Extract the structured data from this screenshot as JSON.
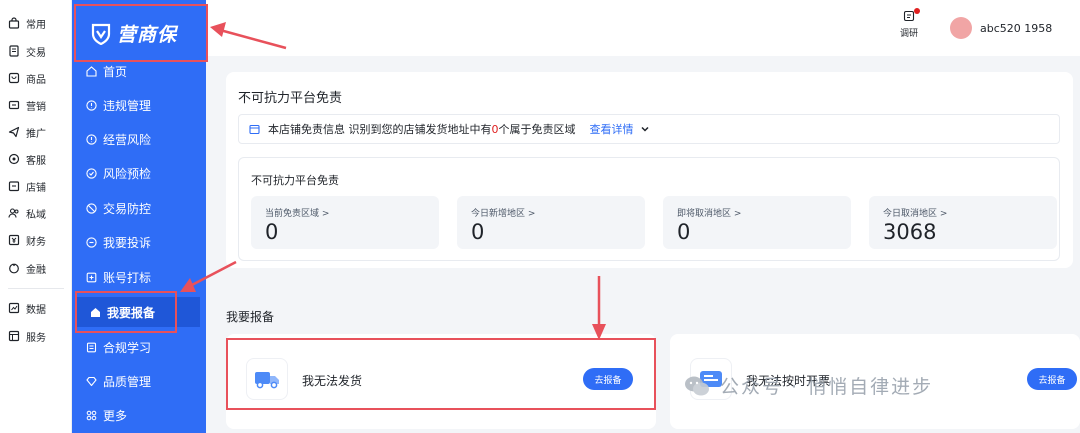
{
  "rail": {
    "items": [
      {
        "label": "常用",
        "icon": "bag-icon"
      },
      {
        "label": "交易",
        "icon": "document-icon"
      },
      {
        "label": "商品",
        "icon": "product-icon"
      },
      {
        "label": "营销",
        "icon": "ticket-icon"
      },
      {
        "label": "推广",
        "icon": "send-icon"
      },
      {
        "label": "客服",
        "icon": "headset-icon"
      },
      {
        "label": "店铺",
        "icon": "store-icon"
      },
      {
        "label": "私域",
        "icon": "people-icon"
      },
      {
        "label": "财务",
        "icon": "finance-icon"
      },
      {
        "label": "金融",
        "icon": "coin-icon"
      },
      {
        "label": "数据",
        "icon": "chart-icon"
      },
      {
        "label": "服务",
        "icon": "service-icon"
      }
    ]
  },
  "sidebar": {
    "logo_text": "营商保",
    "items": [
      {
        "label": "首页"
      },
      {
        "label": "违规管理"
      },
      {
        "label": "经营风险"
      },
      {
        "label": "风险预检"
      },
      {
        "label": "交易防控"
      },
      {
        "label": "我要投诉"
      },
      {
        "label": "账号打标"
      },
      {
        "label": "我要报备"
      },
      {
        "label": "合规学习"
      },
      {
        "label": "品质管理"
      },
      {
        "label": "更多"
      }
    ]
  },
  "header": {
    "survey_label": "调研",
    "user_name": "abc520 1958"
  },
  "card": {
    "title": "不可抗力平台免责",
    "notice": {
      "prefix": "本店铺免责信息  识别到您的店铺发货地址中有",
      "count": "0",
      "suffix": "个属于免责区域",
      "link": "查看详情"
    },
    "inner_title": "不可抗力平台免责",
    "stats": [
      {
        "label": "当前免责区域 >",
        "value": "0"
      },
      {
        "label": "今日新增地区 >",
        "value": "0"
      },
      {
        "label": "即将取消地区 >",
        "value": "0"
      },
      {
        "label": "今日取消地区 >",
        "value": "3068"
      }
    ]
  },
  "report": {
    "title": "我要报备",
    "cards": [
      {
        "label": "我无法发货",
        "button": "去报备"
      },
      {
        "label": "我无法按时开票",
        "button": "去报备"
      }
    ]
  },
  "watermark": "公众号 · 悄悄自律进步",
  "colors": {
    "primary": "#2f6df6",
    "annotation": "#e8515b",
    "background": "#f3f5f8"
  }
}
